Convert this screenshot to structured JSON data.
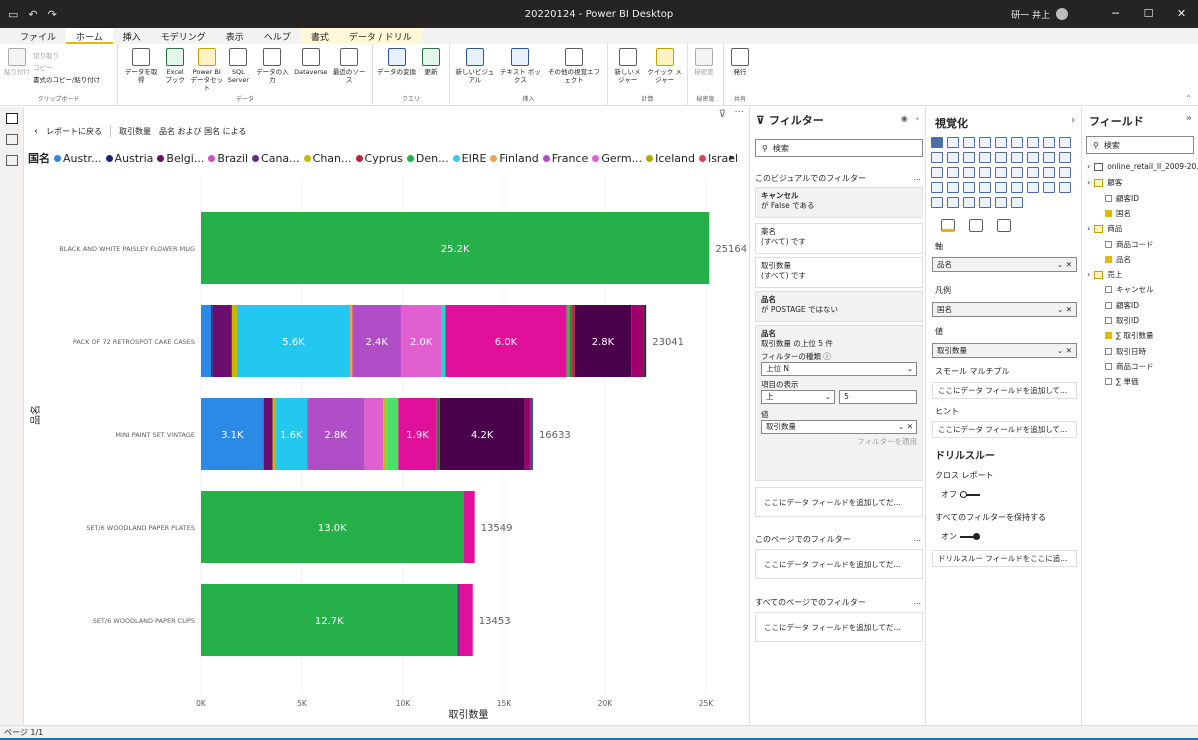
{
  "window": {
    "title": "20220124 - Power BI Desktop",
    "user": "研一 井上"
  },
  "menu": [
    "ファイル",
    "ホーム",
    "挿入",
    "モデリング",
    "表示",
    "ヘルプ",
    "書式",
    "データ / ドリル"
  ],
  "ribbon": {
    "clipboard": {
      "paste": "貼り付け",
      "cut": "切り取り",
      "copy": "コピー",
      "format_copy": "書式のコピー/貼り付け",
      "label": "クリップボード"
    },
    "data": {
      "get": "データを取得",
      "excel": "Excel ブック",
      "pbi": "Power BI データセット",
      "sql": "SQL Server",
      "enter": "データの入力",
      "dataverse": "Dataverse",
      "recent": "最近のソース",
      "label": "データ"
    },
    "query": {
      "transform": "データの変換",
      "refresh": "更新",
      "label": "クエリ"
    },
    "insert": {
      "new_visual": "新しいビジュアル",
      "textbox": "テキスト ボックス",
      "more": "その他の視覚エフェクト",
      "label": "挿入"
    },
    "calc": {
      "measure": "新しいメジャー",
      "quick": "クイック メジャー",
      "label": "計算"
    },
    "sensitivity": {
      "label_btn": "秘密度",
      "label": "秘密度"
    },
    "share": {
      "publish": "発行",
      "label": "共有"
    }
  },
  "canvas": {
    "back": "レポートに戻る",
    "crumb1": "取引数量",
    "crumb2": "品名 および 国名 による",
    "legend_title": "国名",
    "legend": [
      {
        "name": "Austr...",
        "color": "#2b8ae6"
      },
      {
        "name": "Austria",
        "color": "#1a237e"
      },
      {
        "name": "Belgi...",
        "color": "#6a0f6e"
      },
      {
        "name": "Brazil",
        "color": "#d050c0"
      },
      {
        "name": "Cana...",
        "color": "#6a2a8a"
      },
      {
        "name": "Chan...",
        "color": "#c8b800"
      },
      {
        "name": "Cyprus",
        "color": "#c0243c"
      },
      {
        "name": "Den...",
        "color": "#26b04a"
      },
      {
        "name": "EIRE",
        "color": "#3cc8ee"
      },
      {
        "name": "Finland",
        "color": "#f0a050"
      },
      {
        "name": "France",
        "color": "#b04ec8"
      },
      {
        "name": "Germ...",
        "color": "#e060d0"
      },
      {
        "name": "Iceland",
        "color": "#b8a800"
      },
      {
        "name": "Israel",
        "color": "#e0405a"
      }
    ],
    "y_axis_title": "品名",
    "x_axis_title": "取引数量"
  },
  "chart_data": {
    "type": "bar",
    "orientation": "horizontal",
    "stacked": true,
    "x_ticks": [
      "0K",
      "5K",
      "10K",
      "15K",
      "20K",
      "25K"
    ],
    "xlim": [
      0,
      25000
    ],
    "xlabel": "取引数量",
    "ylabel": "品名",
    "categories": [
      "BLACK AND WHITE PAISLEY FLOWER MUG",
      "PACK OF 72 RETROSPOT CAKE CASES",
      "MINI PAINT SET VINTAGE",
      "SET/6 WOODLAND PAPER PLATES",
      "SET/6 WOODLAND PAPER CUPS"
    ],
    "totals": [
      "25164",
      "23041",
      "16633",
      "13549",
      "13453"
    ],
    "rows": [
      [
        {
          "v": 25164,
          "c": "#26b04a",
          "label": "25.2K"
        }
      ],
      [
        {
          "v": 500,
          "c": "#2b8ae6"
        },
        {
          "v": 80,
          "c": "#1a237e"
        },
        {
          "v": 950,
          "c": "#6a0f6e"
        },
        {
          "v": 250,
          "c": "#c8b800"
        },
        {
          "v": 5600,
          "c": "#22c8ee",
          "label": "5.6K"
        },
        {
          "v": 120,
          "c": "#f0a050"
        },
        {
          "v": 2400,
          "c": "#b04ec8",
          "label": "2.4K"
        },
        {
          "v": 2000,
          "c": "#e060d0",
          "label": "2.0K"
        },
        {
          "v": 200,
          "c": "#22d8c8"
        },
        {
          "v": 6000,
          "c": "#e0109a",
          "label": "6.0K"
        },
        {
          "v": 150,
          "c": "#4caf50"
        },
        {
          "v": 100,
          "c": "#2e7d32"
        },
        {
          "v": 150,
          "c": "#c0243c"
        },
        {
          "v": 2800,
          "c": "#4a004a",
          "label": "2.8K"
        },
        {
          "v": 600,
          "c": "#a0006a"
        },
        {
          "v": 141,
          "c": "#333"
        }
      ],
      [
        {
          "v": 3100,
          "c": "#2b8ae6",
          "label": "3.1K"
        },
        {
          "v": 450,
          "c": "#6a0f6e"
        },
        {
          "v": 120,
          "c": "#c8b800"
        },
        {
          "v": 1600,
          "c": "#22c8ee",
          "label": "1.6K"
        },
        {
          "v": 2800,
          "c": "#b04ec8",
          "label": "2.8K"
        },
        {
          "v": 950,
          "c": "#e060d0"
        },
        {
          "v": 150,
          "c": "#c8b800"
        },
        {
          "v": 600,
          "c": "#4ee068"
        },
        {
          "v": 1900,
          "c": "#e0109a",
          "label": "1.9K"
        },
        {
          "v": 150,
          "c": "#2e7d32"
        },
        {
          "v": 4200,
          "c": "#4a004a",
          "label": "4.2K"
        },
        {
          "v": 300,
          "c": "#a0006a"
        },
        {
          "v": 113,
          "c": "#2b579a"
        }
      ],
      [
        {
          "v": 13000,
          "c": "#26b04a",
          "label": "13.0K"
        },
        {
          "v": 549,
          "c": "#e0109a"
        }
      ],
      [
        {
          "v": 12700,
          "c": "#26b04a",
          "label": "12.7K"
        },
        {
          "v": 100,
          "c": "#6a2a8a"
        },
        {
          "v": 653,
          "c": "#e0109a"
        }
      ]
    ]
  },
  "filters": {
    "title": "フィルター",
    "search_placeholder": "検索",
    "visual_section": "このビジュアルでのフィルター",
    "cards": [
      {
        "name": "キャンセル",
        "value": "が False である"
      },
      {
        "name": "薬名",
        "value": "(すべて) です"
      },
      {
        "name": "取引数量",
        "value": "(すべて) です"
      },
      {
        "name": "品名",
        "value": "が POSTAGE ではない"
      }
    ],
    "active": {
      "name": "品名",
      "summary": "取引数量 の上位 5 件",
      "type_label": "フィルターの種類 ⓘ",
      "type_value": "上位 N",
      "show_label": "項目の表示",
      "show_dir": "上",
      "show_n": "5",
      "by_label": "値",
      "by_value": "取引数量",
      "apply": "フィルターを適用"
    },
    "add_field": "ここにデータ フィールドを追加してだ...",
    "page_section": "このページでのフィルター",
    "all_section": "すべてのページでのフィルター",
    "more": "..."
  },
  "viz": {
    "title": "視覚化",
    "axis_label": "軸",
    "axis_value": "品名",
    "legend_label": "凡例",
    "legend_value": "国名",
    "value_label": "値",
    "value_value": "取引数量",
    "small_multiples": "スモール マルチプル",
    "add_field": "ここにデータ フィールドを追加して...",
    "tooltip": "ヒント",
    "drill_title": "ドリルスルー",
    "cross_report": "クロス レポート",
    "off": "オフ",
    "keep_all": "すべてのフィルターを保持する",
    "on": "オン",
    "drill_add": "ドリルスルー フィールドをここに追..."
  },
  "fields": {
    "title": "フィールド",
    "search_placeholder": "検索",
    "items": [
      {
        "label": "online_retail_II_2009-20...",
        "type": "table",
        "indent": 0
      },
      {
        "label": "顧客",
        "type": "group",
        "indent": 0
      },
      {
        "label": "顧客ID",
        "type": "field",
        "checked": false,
        "indent": 1
      },
      {
        "label": "国名",
        "type": "field",
        "checked": true,
        "indent": 1
      },
      {
        "label": "商品",
        "type": "group",
        "indent": 0
      },
      {
        "label": "商品コード",
        "type": "field",
        "checked": false,
        "indent": 1
      },
      {
        "label": "品名",
        "type": "field",
        "checked": true,
        "indent": 1
      },
      {
        "label": "売上",
        "type": "group",
        "indent": 0
      },
      {
        "label": "キャンセル",
        "type": "field",
        "checked": false,
        "indent": 1
      },
      {
        "label": "顧客ID",
        "type": "field",
        "checked": false,
        "indent": 1
      },
      {
        "label": "取引ID",
        "type": "field",
        "checked": false,
        "indent": 1
      },
      {
        "label": "∑ 取引数量",
        "type": "field",
        "checked": true,
        "indent": 1
      },
      {
        "label": "取引日時",
        "type": "field",
        "checked": false,
        "indent": 1
      },
      {
        "label": "商品コード",
        "type": "field",
        "checked": false,
        "indent": 1
      },
      {
        "label": "∑ 単価",
        "type": "field",
        "checked": false,
        "indent": 1
      }
    ]
  },
  "status": {
    "page": "ページ 1/1"
  }
}
